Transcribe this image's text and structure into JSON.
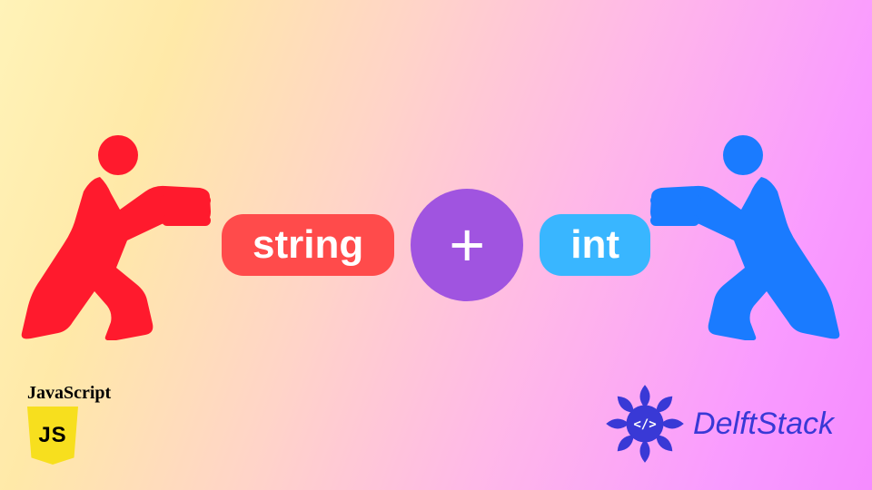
{
  "diagram": {
    "left_item": "string",
    "operator": "+",
    "right_item": "int",
    "colors": {
      "left_capsule": "#ff4b4b",
      "operator_circle": "#a054e0",
      "right_capsule": "#39b6ff",
      "left_figure": "#ff1a2d",
      "right_figure": "#1a7bff"
    }
  },
  "logos": {
    "js_label": "JavaScript",
    "js_shield": "JS",
    "brand_name": "DelftStack"
  }
}
